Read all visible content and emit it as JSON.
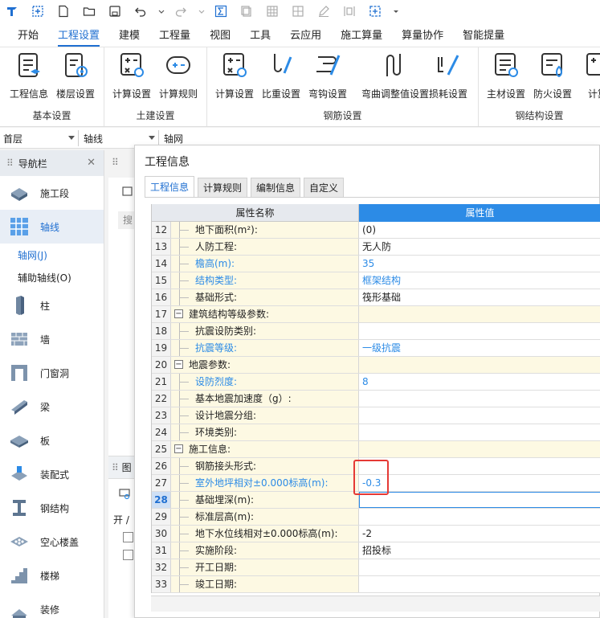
{
  "menu": {
    "items": [
      "开始",
      "工程设置",
      "建模",
      "工程量",
      "视图",
      "工具",
      "云应用",
      "施工算量",
      "算量协作",
      "智能提量"
    ],
    "active": 1
  },
  "ribbon": {
    "groups": [
      {
        "label": "基本设置",
        "buttons": [
          "工程信息",
          "楼层设置"
        ]
      },
      {
        "label": "土建设置",
        "buttons": [
          "计算设置",
          "计算规则"
        ]
      },
      {
        "label": "钢筋设置",
        "buttons": [
          "计算设置",
          "比重设置",
          "弯钩设置",
          "弯曲调整值设置",
          "损耗设置"
        ]
      },
      {
        "label": "钢结构设置",
        "buttons": [
          "主材设置",
          "防火设置",
          "计算"
        ]
      }
    ]
  },
  "dropdowns": {
    "floor": "首层",
    "axis": "轴线",
    "grid": "轴网"
  },
  "nav": {
    "title": "导航栏",
    "items": [
      {
        "label": "施工段",
        "icon": "construction-section-icon"
      },
      {
        "label": "轴线",
        "icon": "axis-grid-icon",
        "selected": true
      },
      {
        "label": "柱",
        "icon": "column-icon"
      },
      {
        "label": "墙",
        "icon": "wall-icon"
      },
      {
        "label": "门窗洞",
        "icon": "door-window-icon"
      },
      {
        "label": "梁",
        "icon": "beam-icon"
      },
      {
        "label": "板",
        "icon": "slab-icon"
      },
      {
        "label": "装配式",
        "icon": "prefab-icon"
      },
      {
        "label": "钢结构",
        "icon": "steel-structure-icon"
      },
      {
        "label": "空心楼盖",
        "icon": "hollow-floor-icon"
      },
      {
        "label": "楼梯",
        "icon": "stair-icon"
      },
      {
        "label": "装修",
        "icon": "decoration-icon"
      }
    ],
    "sub_items": [
      {
        "label": "轴网(J)",
        "active": true
      },
      {
        "label": "辅助轴线(O)",
        "active": false
      }
    ]
  },
  "mid_panel": {
    "search_hint": "搜",
    "low_label": "图",
    "low_open": "开 /"
  },
  "dialog": {
    "title": "工程信息",
    "tabs": [
      "工程信息",
      "计算规则",
      "编制信息",
      "自定义"
    ],
    "active_tab": 0,
    "columns": [
      "属性名称",
      "属性值"
    ],
    "rows": [
      {
        "n": "12",
        "name": "地下面积(m²):",
        "value": "(0)",
        "blue": false,
        "group": false
      },
      {
        "n": "13",
        "name": "人防工程:",
        "value": "无人防",
        "blue": false,
        "group": false
      },
      {
        "n": "14",
        "name": "檐高(m):",
        "value": "35",
        "blue": true,
        "group": false
      },
      {
        "n": "15",
        "name": "结构类型:",
        "value": "框架结构",
        "blue": true,
        "group": false
      },
      {
        "n": "16",
        "name": "基础形式:",
        "value": "筏形基础",
        "blue": false,
        "group": false
      },
      {
        "n": "17",
        "name": "建筑结构等级参数:",
        "value": "",
        "blue": false,
        "group": true
      },
      {
        "n": "18",
        "name": "抗震设防类别:",
        "value": "",
        "blue": false,
        "group": false
      },
      {
        "n": "19",
        "name": "抗震等级:",
        "value": "一级抗震",
        "blue": true,
        "group": false
      },
      {
        "n": "20",
        "name": "地震参数:",
        "value": "",
        "blue": false,
        "group": true
      },
      {
        "n": "21",
        "name": "设防烈度:",
        "value": "8",
        "blue": true,
        "group": false
      },
      {
        "n": "22",
        "name": "基本地震加速度（g）:",
        "value": "",
        "blue": false,
        "group": false
      },
      {
        "n": "23",
        "name": "设计地震分组:",
        "value": "",
        "blue": false,
        "group": false
      },
      {
        "n": "24",
        "name": "环境类别:",
        "value": "",
        "blue": false,
        "group": false
      },
      {
        "n": "25",
        "name": "施工信息:",
        "value": "",
        "blue": false,
        "group": true
      },
      {
        "n": "26",
        "name": "钢筋接头形式:",
        "value": "",
        "blue": false,
        "group": false
      },
      {
        "n": "27",
        "name": "室外地坪相对±0.000标高(m):",
        "value": "-0.3",
        "blue": true,
        "group": false
      },
      {
        "n": "28",
        "name": "基础埋深(m):",
        "value": "",
        "blue": false,
        "group": false,
        "current": true
      },
      {
        "n": "29",
        "name": "标准层高(m):",
        "value": "",
        "blue": false,
        "group": false
      },
      {
        "n": "30",
        "name": "地下水位线相对±0.000标高(m):",
        "value": "-2",
        "blue": false,
        "group": false
      },
      {
        "n": "31",
        "name": "实施阶段:",
        "value": "招投标",
        "blue": false,
        "group": false
      },
      {
        "n": "32",
        "name": "开工日期:",
        "value": "",
        "blue": false,
        "group": false
      },
      {
        "n": "33",
        "name": "竣工日期:",
        "value": "",
        "blue": false,
        "group": false
      }
    ]
  },
  "colors": {
    "accent": "#1f6fd1",
    "header_value": "#2c8be6",
    "name_bg": "#fdf9e3",
    "highlight": "#e53935"
  }
}
